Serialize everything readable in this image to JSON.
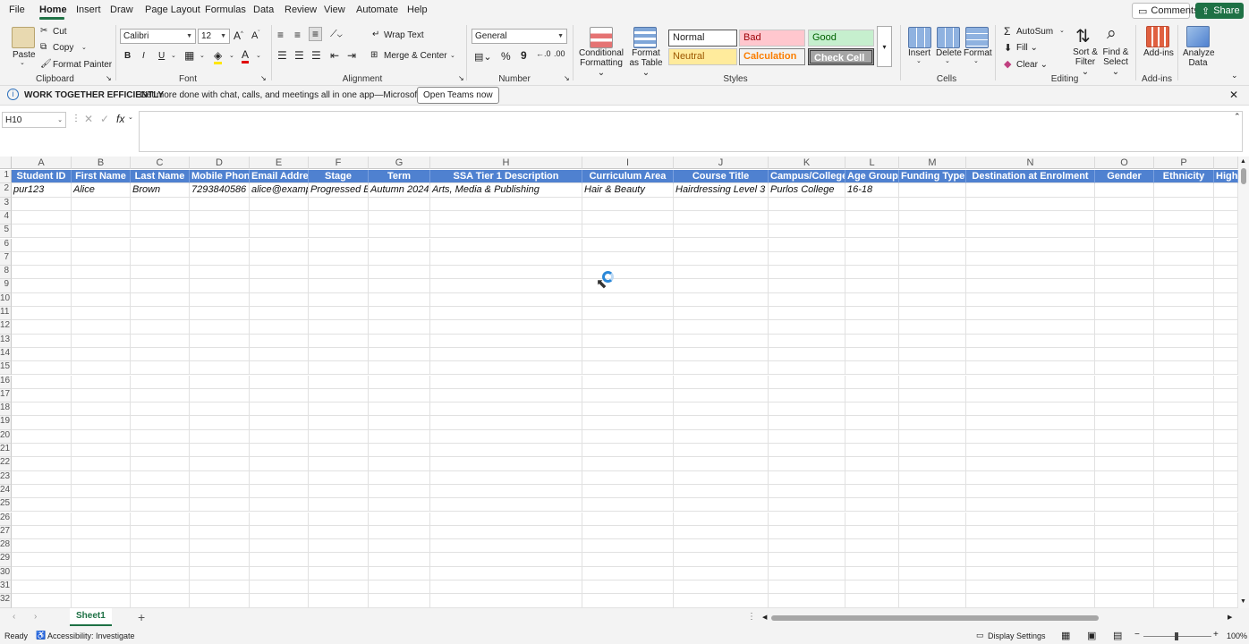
{
  "menu": {
    "items": [
      "File",
      "Home",
      "Insert",
      "Draw",
      "Page Layout",
      "Formulas",
      "Data",
      "Review",
      "View",
      "Automate",
      "Help"
    ],
    "active": "Home",
    "comments_label": "Comments",
    "share_label": "Share"
  },
  "ribbon": {
    "clipboard": {
      "paste": "Paste",
      "cut": "Cut",
      "copy": "Copy",
      "format_painter": "Format Painter",
      "label": "Clipboard"
    },
    "font": {
      "name": "Calibri",
      "size": "12",
      "label": "Font",
      "bold": "B",
      "italic": "I",
      "underline": "U"
    },
    "alignment": {
      "wrap_text": "Wrap Text",
      "merge_center": "Merge & Center",
      "label": "Alignment"
    },
    "number": {
      "format": "General",
      "label": "Number",
      "percent": "%"
    },
    "styles": {
      "conditional_formatting": "Conditional Formatting",
      "format_as_table": "Format as Table",
      "normal": "Normal",
      "bad": "Bad",
      "good": "Good",
      "neutral": "Neutral",
      "calculation": "Calculation",
      "check_cell": "Check Cell",
      "label": "Styles"
    },
    "cells": {
      "insert": "Insert",
      "delete": "Delete",
      "format": "Format",
      "label": "Cells"
    },
    "editing": {
      "autosum": "AutoSum",
      "fill": "Fill",
      "clear": "Clear",
      "sort_filter": "Sort & Filter",
      "find_select": "Find & Select",
      "label": "Editing"
    },
    "addins": {
      "addins": "Add-ins",
      "analyze": "Analyze Data",
      "label": "Add-ins"
    }
  },
  "message_bar": {
    "title": "WORK TOGETHER EFFICIENTLY",
    "text": "Get more done with chat, calls, and meetings all in one app—Microsoft Teams.",
    "button": "Open Teams now"
  },
  "formula_bar": {
    "name_box": "H10",
    "fx": "fx",
    "value": ""
  },
  "grid": {
    "columns": [
      "A",
      "B",
      "C",
      "D",
      "E",
      "F",
      "G",
      "H",
      "I",
      "J",
      "K",
      "L",
      "M",
      "N",
      "O",
      "P",
      ""
    ],
    "header_row": [
      "Student ID",
      "First Name",
      "Last Name",
      "Mobile Phone",
      "Email Address",
      "Stage",
      "Term",
      "SSA Tier 1 Description",
      "Curriculum Area",
      "Course Title",
      "Campus/College",
      "Age Group",
      "Funding Type",
      "Destination at Enrolment",
      "Gender",
      "Ethnicity",
      "High"
    ],
    "data_row": [
      "pur123",
      "Alice",
      "Brown",
      "7293840586",
      "alice@example.com",
      "Progressed Ex",
      "Autumn 2024",
      "Arts, Media & Publishing",
      "Hair & Beauty",
      "Hairdressing Level 3",
      "Purlos College",
      "16-18",
      "",
      "",
      "",
      "",
      ""
    ],
    "row_count": 32
  },
  "sheet_tabs": {
    "active": "Sheet1",
    "add": "+"
  },
  "status": {
    "ready": "Ready",
    "accessibility": "Accessibility: Investigate",
    "display_settings": "Display Settings",
    "zoom": "100%"
  },
  "colors": {
    "header_fill": "#4f81d0",
    "accent": "#217346",
    "share": "#1e7145"
  }
}
